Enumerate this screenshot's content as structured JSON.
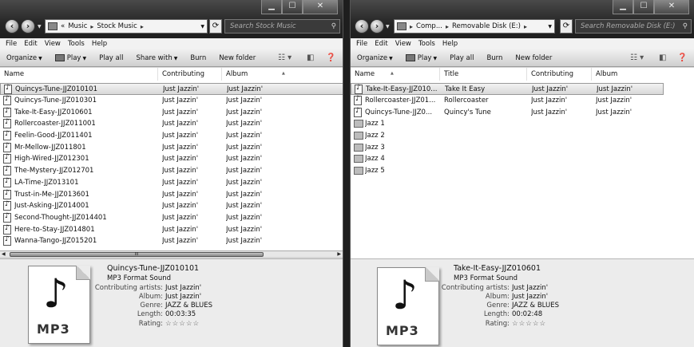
{
  "left": {
    "address": {
      "overflow": "«",
      "crumbs": [
        "Music",
        "Stock Music"
      ]
    },
    "search_placeholder": "Search Stock Music",
    "menu": [
      "File",
      "Edit",
      "View",
      "Tools",
      "Help"
    ],
    "commands": {
      "organize": "Organize",
      "play": "Play",
      "play_all": "Play all",
      "share_with": "Share with",
      "burn": "Burn",
      "new_folder": "New folder"
    },
    "columns": {
      "name": "Name",
      "contributing_artists": "Contributing artists",
      "album": "Album"
    },
    "rows": [
      {
        "name": "Quincys-Tune-JJZ010101",
        "artist": "Just Jazzin'",
        "album": "Just Jazzin'"
      },
      {
        "name": "Quincys-Tune-JJZ010301",
        "artist": "Just Jazzin'",
        "album": "Just Jazzin'"
      },
      {
        "name": "Take-It-Easy-JJZ010601",
        "artist": "Just Jazzin'",
        "album": "Just Jazzin'"
      },
      {
        "name": "Rollercoaster-JJZ011001",
        "artist": "Just Jazzin'",
        "album": "Just Jazzin'"
      },
      {
        "name": "Feelin-Good-JJZ011401",
        "artist": "Just Jazzin'",
        "album": "Just Jazzin'"
      },
      {
        "name": "Mr-Mellow-JJZ011801",
        "artist": "Just Jazzin'",
        "album": "Just Jazzin'"
      },
      {
        "name": "High-Wired-JJZ012301",
        "artist": "Just Jazzin'",
        "album": "Just Jazzin'"
      },
      {
        "name": "The-Mystery-JJZ012701",
        "artist": "Just Jazzin'",
        "album": "Just Jazzin'"
      },
      {
        "name": "LA-Time-JJZ013101",
        "artist": "Just Jazzin'",
        "album": "Just Jazzin'"
      },
      {
        "name": "Trust-in-Me-JJZ013601",
        "artist": "Just Jazzin'",
        "album": "Just Jazzin'"
      },
      {
        "name": "Just-Asking-JJZ014001",
        "artist": "Just Jazzin'",
        "album": "Just Jazzin'"
      },
      {
        "name": "Second-Thought-JJZ014401",
        "artist": "Just Jazzin'",
        "album": "Just Jazzin'"
      },
      {
        "name": "Here-to-Stay-JJZ014801",
        "artist": "Just Jazzin'",
        "album": "Just Jazzin'"
      },
      {
        "name": "Wanna-Tango-JJZ015201",
        "artist": "Just Jazzin'",
        "album": "Just Jazzin'"
      }
    ],
    "scroll_grip": "III",
    "details": {
      "icon_label": "MP3",
      "title": "Quincys-Tune-JJZ010101",
      "type": "MP3 Format Sound",
      "fields": [
        {
          "key": "Contributing artists:",
          "value": "Just Jazzin'"
        },
        {
          "key": "Album:",
          "value": "Just Jazzin'"
        },
        {
          "key": "Genre:",
          "value": "JAZZ & BLUES"
        },
        {
          "key": "Length:",
          "value": "00:03:35"
        },
        {
          "key": "Rating:",
          "value": "☆☆☆☆☆"
        }
      ]
    }
  },
  "right": {
    "address": {
      "crumbs": [
        "Comp...",
        "Removable Disk (E:)"
      ]
    },
    "search_placeholder": "Search Removable Disk (E:)",
    "menu": [
      "File",
      "Edit",
      "View",
      "Tools",
      "Help"
    ],
    "commands": {
      "organize": "Organize",
      "play": "Play",
      "play_all": "Play all",
      "burn": "Burn",
      "new_folder": "New folder"
    },
    "columns": {
      "name": "Name",
      "title": "Title",
      "contributing_artists": "Contributing artists",
      "album": "Album"
    },
    "rows": [
      {
        "kind": "file",
        "name": "Take-It-Easy-JJZ010...",
        "title": "Take It Easy",
        "artist": "Just Jazzin'",
        "album": "Just Jazzin'"
      },
      {
        "kind": "file",
        "name": "Rollercoaster-JJZ01...",
        "title": "Rollercoaster",
        "artist": "Just Jazzin'",
        "album": "Just Jazzin'"
      },
      {
        "kind": "file",
        "name": "Quincys-Tune-JJZ0...",
        "title": "Quincy's Tune",
        "artist": "Just Jazzin'",
        "album": "Just Jazzin'"
      },
      {
        "kind": "folder",
        "name": "Jazz 1"
      },
      {
        "kind": "folder",
        "name": "Jazz 2"
      },
      {
        "kind": "folder",
        "name": "Jazz 3"
      },
      {
        "kind": "folder",
        "name": "Jazz 4"
      },
      {
        "kind": "folder",
        "name": "Jazz 5"
      }
    ],
    "details": {
      "icon_label": "MP3",
      "title": "Take-It-Easy-JJZ010601",
      "type": "MP3 Format Sound",
      "fields": [
        {
          "key": "Contributing artists:",
          "value": "Just Jazzin'"
        },
        {
          "key": "Album:",
          "value": "Just Jazzin'"
        },
        {
          "key": "Genre:",
          "value": "JAZZ & BLUES"
        },
        {
          "key": "Length:",
          "value": "00:02:48"
        },
        {
          "key": "Rating:",
          "value": "☆☆☆☆☆"
        }
      ]
    }
  }
}
